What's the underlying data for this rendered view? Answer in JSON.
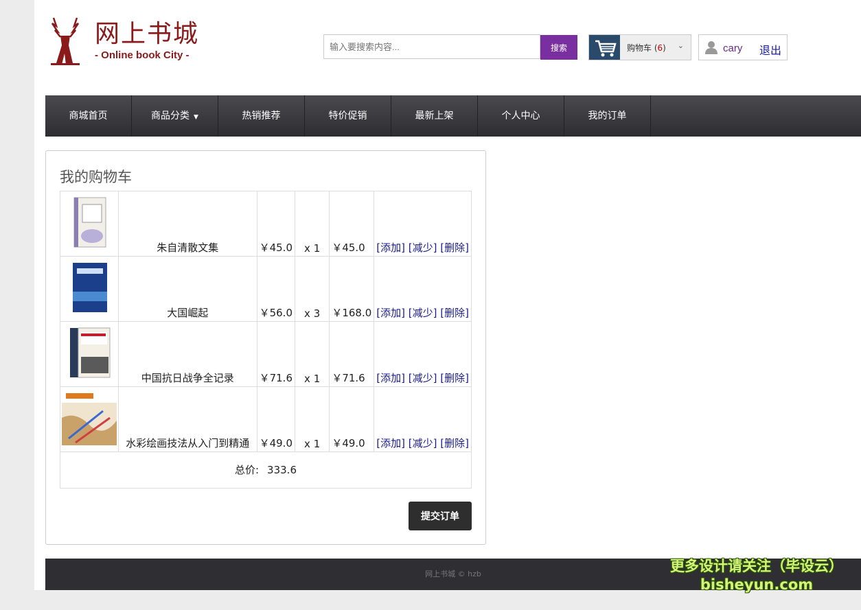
{
  "header": {
    "logo_cn": "网上书城",
    "logo_en": "- Online book City -",
    "search_placeholder": "输入要搜索内容...",
    "search_button": "搜索",
    "cart_label": "购物车",
    "cart_count_open": " (",
    "cart_count": "6",
    "cart_count_close": ")",
    "username": "cary",
    "logout": "退出"
  },
  "nav": [
    {
      "label": "商城首页"
    },
    {
      "label": "商品分类",
      "has_dropdown": true
    },
    {
      "label": "热销推荐"
    },
    {
      "label": "特价促销"
    },
    {
      "label": "最新上架"
    },
    {
      "label": "个人中心"
    },
    {
      "label": "我的订单"
    }
  ],
  "cart": {
    "title": "我的购物车",
    "items": [
      {
        "name": "朱自清散文集",
        "price": "￥45.0",
        "qty": "x 1",
        "subtotal": "￥45.0",
        "add": "[添加]",
        "reduce": "[减少]",
        "delete": "[删除]"
      },
      {
        "name": "大国崛起",
        "price": "￥56.0",
        "qty": "x 3",
        "subtotal": "￥168.0",
        "add": "[添加]",
        "reduce": "[减少]",
        "delete": "[删除]"
      },
      {
        "name": "中国抗日战争全记录",
        "price": "￥71.6",
        "qty": "x 1",
        "subtotal": "￥71.6",
        "add": "[添加]",
        "reduce": "[减少]",
        "delete": "[删除]"
      },
      {
        "name": "水彩绘画技法从入门到精通",
        "price": "￥49.0",
        "qty": "x 1",
        "subtotal": "￥49.0",
        "add": "[添加]",
        "reduce": "[减少]",
        "delete": "[删除]"
      }
    ],
    "total_label": "总价:",
    "total_value": "333.6",
    "submit_button": "提交订单"
  },
  "footer": {
    "text": "网上书城 © hzb"
  },
  "watermark": {
    "line1": "更多设计请关注（毕设云）",
    "line2": "bisheyun.com"
  },
  "colors": {
    "brand": "#8b1a1a",
    "search_button": "#7a2fa0",
    "nav_bg": "#3a3a3e",
    "link": "#1a1a90",
    "submit_button": "#2e2e2e"
  }
}
